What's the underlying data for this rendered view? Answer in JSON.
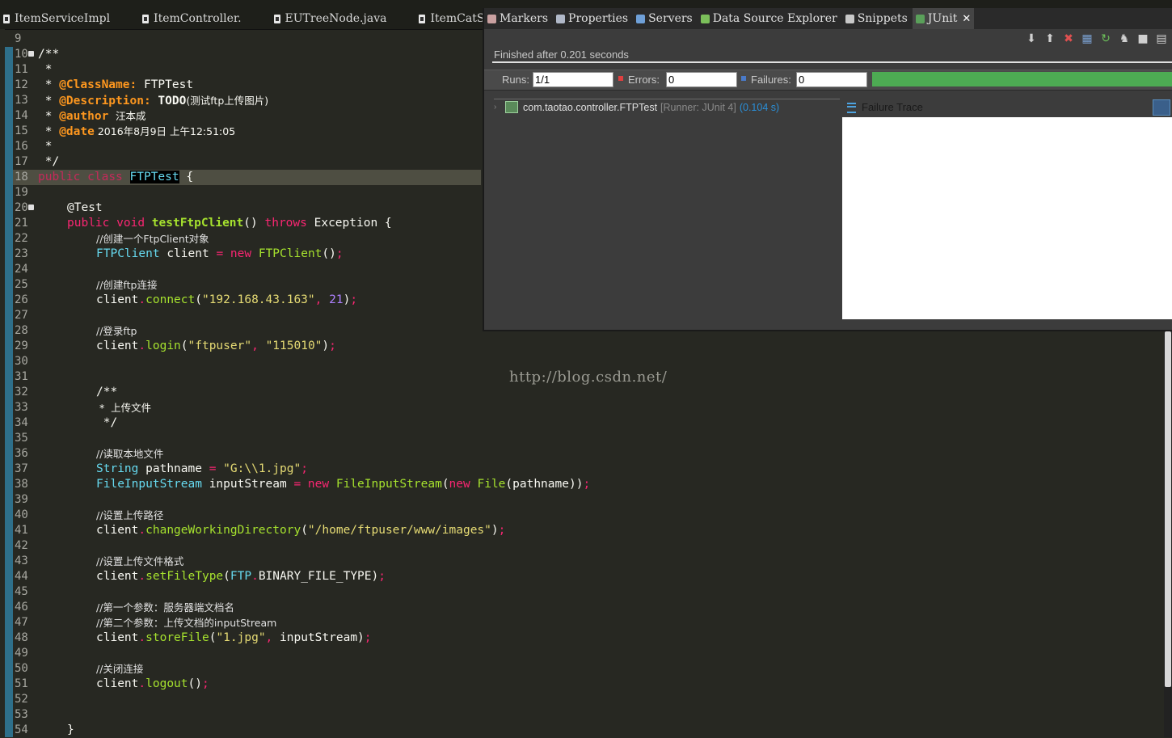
{
  "editor_tabs": [
    "ItemServiceImpl",
    "ItemController.",
    "EUTreeNode.java",
    "ItemCatSe"
  ],
  "view_tabs": [
    "Markers",
    "Properties",
    "Servers",
    "Data Source Explorer",
    "Snippets",
    "JUnit"
  ],
  "junit": {
    "finished": "Finished after 0.201 seconds",
    "runs_label": "Runs:",
    "runs_value": "1/1",
    "errors_label": "Errors:",
    "errors_value": "0",
    "failures_label": "Failures:",
    "failures_value": "0",
    "test_class": "com.taotao.controller.FTPTest",
    "runner": "[Runner: JUnit 4]",
    "duration": "(0.104 s)",
    "failure_trace": "Failure Trace",
    "progress_color": "#4dab53"
  },
  "watermark": "http://blog.csdn.net/",
  "code": {
    "n9": "9",
    "n10": "10",
    "n11": "11",
    "n12": "12",
    "n13": "13",
    "n14": "14",
    "n15": "15",
    "n16": "16",
    "n17": "17",
    "n18": "18",
    "n19": "19",
    "n20": "20",
    "n21": "21",
    "n22": "22",
    "n23": "23",
    "n24": "24",
    "n25": "25",
    "n26": "26",
    "n27": "27",
    "n28": "28",
    "n29": "29",
    "n30": "30",
    "n31": "31",
    "n32": "32",
    "n33": "33",
    "n34": "34",
    "n35": "35",
    "n36": "36",
    "n37": "37",
    "n38": "38",
    "n39": "39",
    "n40": "40",
    "n41": "41",
    "n42": "42",
    "n43": "43",
    "n44": "44",
    "n45": "45",
    "n46": "46",
    "n47": "47",
    "n48": "48",
    "n49": "49",
    "n50": "50",
    "n51": "51",
    "n52": "52",
    "n53": "53",
    "n54": "54",
    "javadoc_open": "/**",
    "star": " *",
    "t_classname": "@ClassName:",
    "v_classname": " FTPTest",
    "t_description": "@Description:",
    "v_todo": " TODO",
    "v_description_cn": "(测试ftp上传图片)",
    "t_author": "@author",
    "v_author": "汪本成",
    "t_date": "@date",
    "v_date_a": " 2016年8月9日 上午12:51:05",
    "javadoc_close": " */",
    "kw_public": "public",
    "kw_class": "class",
    "class_name": "FTPTest",
    "brace_open": " {",
    "annotation_test": "@Test",
    "kw_void": "void",
    "method_name": "testFtpClient",
    "kw_throws": "throws",
    "exception": "Exception {",
    "cm_create_client": "//创建一个FtpClient对象",
    "ftpclient_type": "FTPClient",
    "v_client": "client",
    "kw_new": "new",
    "ctor_ftpclient": "FTPClient",
    "cm_connect": "//创建ftp连接",
    "m_connect": "connect",
    "s_ip": "\"192.168.43.163\"",
    "n_port": "21",
    "cm_login": "//登录ftp",
    "m_login": "login",
    "s_user": "\"ftpuser\"",
    "s_pass": "\"115010\"",
    "cm_block_open": "/**",
    "cm_block_mid": " *  上传文件",
    "cm_block_close": " */",
    "cm_read_local": "//读取本地文件",
    "type_string": "String",
    "v_pathname": "pathname",
    "s_path": "\"G:\\\\1.jpg\"",
    "type_fis": "FileInputStream",
    "v_inputstream": "inputStream",
    "type_file": "File",
    "cm_set_path": "//设置上传路径",
    "m_cwd": "changeWorkingDirectory",
    "s_remote": "\"/home/ftpuser/www/images\"",
    "cm_set_format": "//设置上传文件格式",
    "m_setfiletype": "setFileType",
    "c_ftp": "FTP",
    "c_binary": "BINARY_FILE_TYPE",
    "cm_param1": "//第一个参数：服务器端文档名",
    "cm_param2": "//第二个参数：上传文档的inputStream",
    "m_storefile": "storeFile",
    "s_filename": "\"1.jpg\"",
    "cm_close": "//关闭连接",
    "m_logout": "logout",
    "brace_close": "}"
  }
}
